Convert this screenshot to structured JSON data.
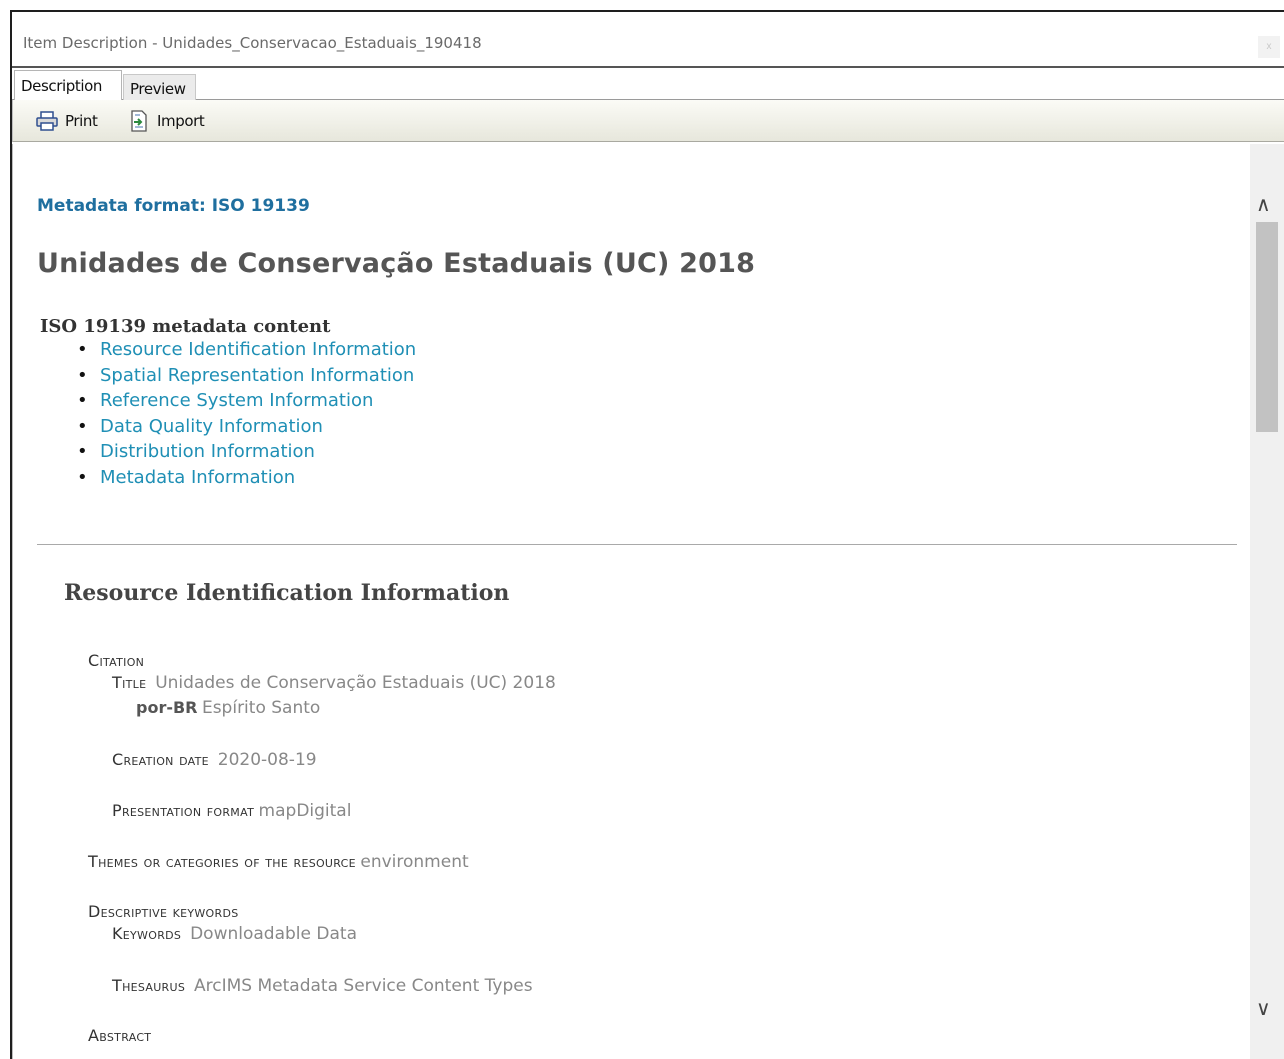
{
  "window": {
    "title": "Item Description - Unidades_Conservacao_Estaduais_190418",
    "close_label": "x"
  },
  "tabs": [
    {
      "label": "Description"
    },
    {
      "label": "Preview"
    }
  ],
  "toolbar": {
    "print_label": "Print",
    "import_label": "Import"
  },
  "doc": {
    "metadata_format": "Metadata format: ISO 19139",
    "title": "Unidades de Conservação Estaduais (UC) 2018",
    "iso_heading": "ISO 19139 metadata content",
    "toc": [
      "Resource Identification Information",
      "Spatial Representation Information",
      "Reference System Information",
      "Data Quality Information",
      "Distribution Information",
      "Metadata Information"
    ],
    "section_heading": "Resource Identification Information",
    "citation_label": "Citation",
    "title_label": "Title",
    "title_value": "Unidades de Conservação Estaduais (UC) 2018",
    "lang_label": "por-BR",
    "lang_value": "Espírito Santo",
    "creation_date_label": "Creation date",
    "creation_date_value": "2020-08-19",
    "presentation_label": "Presentation format",
    "presentation_value": "mapDigital",
    "themes_label": "Themes or categories of the resource",
    "themes_value": "environment",
    "keywords_head": "Descriptive keywords",
    "keywords_label": "Keywords",
    "keywords_value": "Downloadable Data",
    "thesaurus_label": "Thesaurus",
    "thesaurus_value": "ArcIMS Metadata Service Content Types",
    "abstract_label": "Abstract"
  }
}
